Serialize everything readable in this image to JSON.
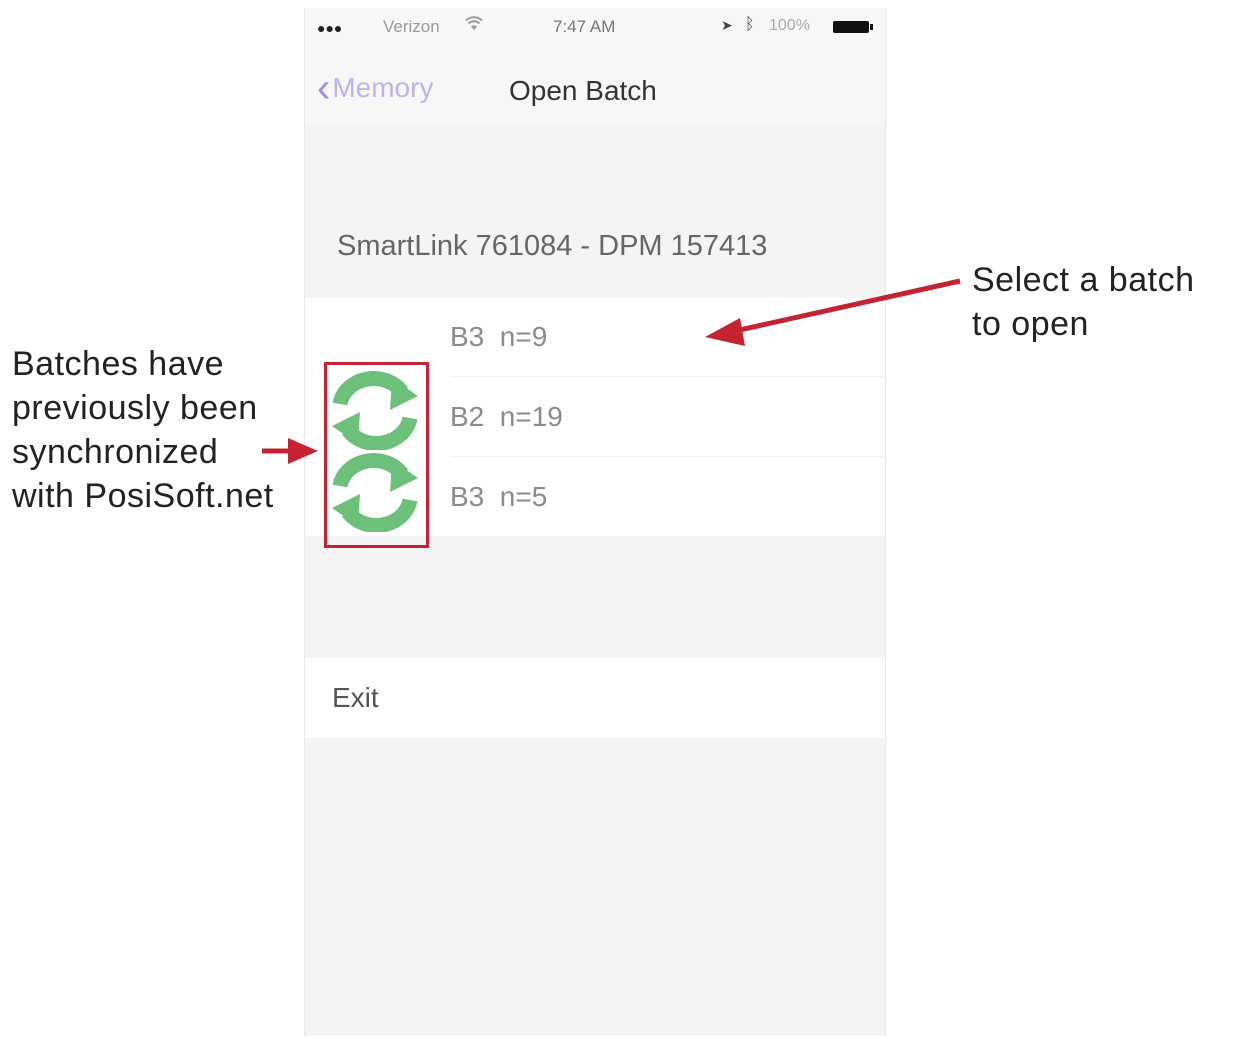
{
  "status_bar": {
    "signal": "●●●",
    "carrier": "Verizon",
    "wifi_icon": "wifi-icon",
    "time": "7:47 AM",
    "location_icon": "location-arrow-icon",
    "bluetooth_icon": "bluetooth-icon",
    "battery_percent": "100%",
    "battery_level": 1.0
  },
  "nav": {
    "back_label": "Memory",
    "title": "Open Batch"
  },
  "device_header": "SmartLink 761084 - DPM 157413",
  "batches": [
    {
      "label": "B3  n=9",
      "synced": false
    },
    {
      "label": "B2  n=19",
      "synced": true
    },
    {
      "label": "B3  n=5",
      "synced": true
    }
  ],
  "exit_label": "Exit",
  "annotations": {
    "left": [
      "Batches have",
      "previously been",
      "synchronized",
      "with PosiSoft.net"
    ],
    "right": [
      "Select a batch",
      "to open"
    ],
    "color": "#c42331"
  },
  "colors": {
    "accent": "#9993d8",
    "sync_icon": "#6cc07a",
    "highlight": "#c42331"
  }
}
